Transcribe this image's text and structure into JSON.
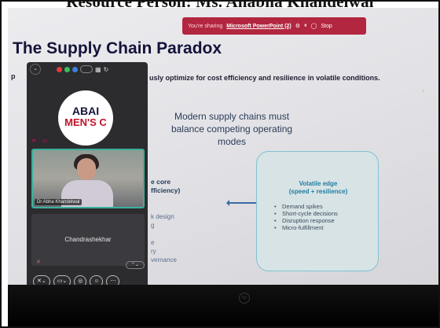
{
  "caption": "Resource Person: Ms. Anabha Khandelwal",
  "share_bar": {
    "prefix": "You're sharing",
    "app_link": "Microsoft PowerPoint (2)",
    "stop_label": "Stop"
  },
  "slide": {
    "title": "The Supply Chain Paradox",
    "subtitle_prefix": "p",
    "subtitle": "usly optimize for cost efficiency and resilience in volatile conditions.",
    "center_text": "Modern supply chains must balance competing operating modes",
    "core_heading_line1": "e core",
    "core_heading_line2": "fficiency)",
    "core_items": [
      "k design",
      "g",
      "",
      "e",
      "ry",
      "vernance"
    ],
    "volatile_title_line1": "Volatile edge",
    "volatile_title_line2": "(speed + resilience)",
    "volatile_items": [
      "Demand spikes",
      "Short-cycle decisions",
      "Disruption response",
      "Micro-fulfillment"
    ]
  },
  "meeting_panel": {
    "logo_line1": "ABAI",
    "logo_line2": "MEN'S C",
    "participant1_name": "Dr Abha Khandelwal",
    "participant2_name": "Chandrashekhar"
  },
  "colors": {
    "share_bar": "#b3263f",
    "volatile_border": "#7fc2cf",
    "volatile_title": "#1e7fa1",
    "active_speaker_border": "#38b09a"
  }
}
